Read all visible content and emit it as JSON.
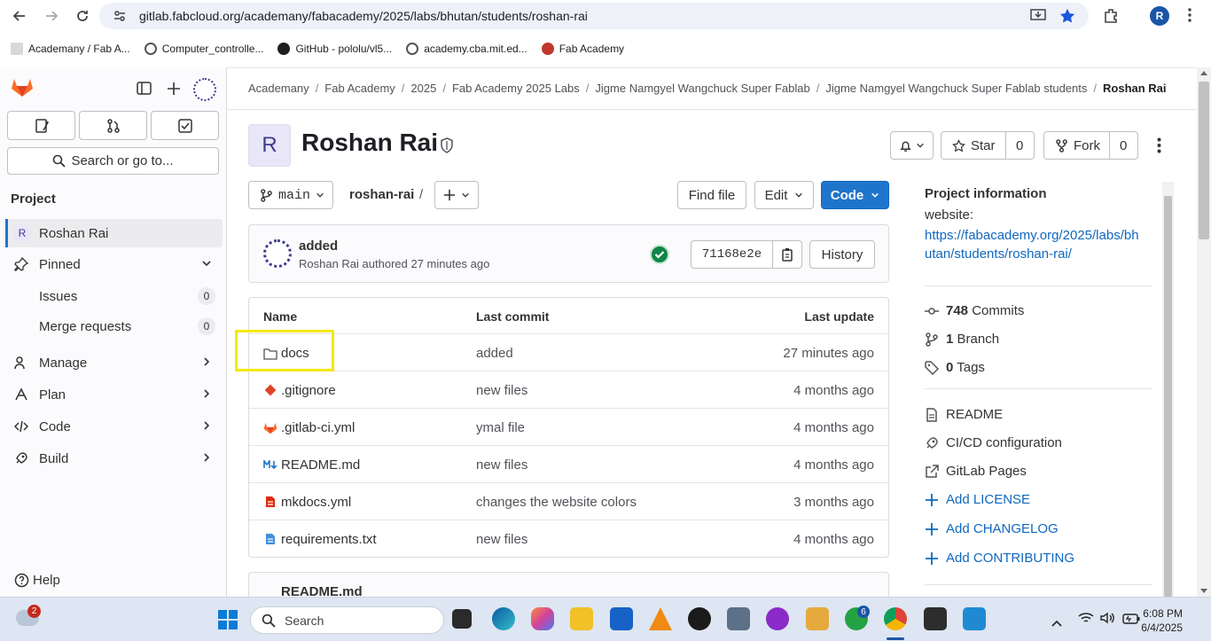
{
  "browser": {
    "url": "gitlab.fabcloud.org/academany/fabacademy/2025/labs/bhutan/students/roshan-rai",
    "profile_initial": "R",
    "bookmarks": [
      "Academany / Fab A...",
      "Computer_controlle...",
      "GitHub - pololu/vl5...",
      "academy.cba.mit.ed...",
      "Fab Academy"
    ]
  },
  "sidebar": {
    "search_label": "Search or go to...",
    "section_label": "Project",
    "project_initial": "R",
    "project_name": "Roshan Rai",
    "pinned_label": "Pinned",
    "issues_label": "Issues",
    "issues_count": "0",
    "mr_label": "Merge requests",
    "mr_count": "0",
    "manage_label": "Manage",
    "plan_label": "Plan",
    "code_label": "Code",
    "build_label": "Build",
    "help_label": "Help"
  },
  "breadcrumb": [
    "Academany",
    "Fab Academy",
    "2025",
    "Fab Academy 2025 Labs",
    "Jigme Namgyel Wangchuck Super Fablab",
    "Jigme Namgyel Wangchuck Super Fablab students",
    "Roshan Rai"
  ],
  "project": {
    "initial": "R",
    "title": "Roshan Rai",
    "star_label": "Star",
    "star_count": "0",
    "fork_label": "Fork",
    "fork_count": "0"
  },
  "repo_bar": {
    "branch": "main",
    "path": "roshan-rai",
    "path_sep": "/",
    "find_file": "Find file",
    "edit": "Edit",
    "code": "Code"
  },
  "last_commit": {
    "message": "added",
    "author_line": "Roshan Rai authored 27 minutes ago",
    "sha": "71168e2e",
    "history": "History"
  },
  "file_table": {
    "headers": {
      "name": "Name",
      "last_commit": "Last commit",
      "last_update": "Last update"
    },
    "rows": [
      {
        "name": "docs",
        "commit": "added",
        "updated": "27 minutes ago",
        "icon": "folder-icon"
      },
      {
        "name": ".gitignore",
        "commit": "new files",
        "updated": "4 months ago",
        "icon": "git-icon"
      },
      {
        "name": ".gitlab-ci.yml",
        "commit": "ymal file",
        "updated": "4 months ago",
        "icon": "gitlab-icon"
      },
      {
        "name": "README.md",
        "commit": "new files",
        "updated": "4 months ago",
        "icon": "markdown-icon"
      },
      {
        "name": "mkdocs.yml",
        "commit": "changes the website colors",
        "updated": "3 months ago",
        "icon": "yaml-icon"
      },
      {
        "name": "requirements.txt",
        "commit": "new files",
        "updated": "4 months ago",
        "icon": "text-file-icon"
      }
    ]
  },
  "readme_header": "README.md",
  "info": {
    "title": "Project information",
    "website_label": "website:",
    "website_line1": "https://fabacademy.org/2025/labs/bh",
    "website_line2": "utan/students/roshan-rai/",
    "commits_count": "748",
    "commits_label": "Commits",
    "branch_count": "1",
    "branch_label": "Branch",
    "tags_count": "0",
    "tags_label": "Tags",
    "readme": "README",
    "cicd": "CI/CD configuration",
    "pages": "GitLab Pages",
    "add_license": "Add LICENSE",
    "add_changelog": "Add CHANGELOG",
    "add_contributing": "Add CONTRIBUTING"
  },
  "taskbar": {
    "weather_badge": "2",
    "search_label": "Search",
    "whatsapp_badge": "6",
    "time": "6:08 PM",
    "date": "6/4/2025"
  },
  "colors": {
    "accent": "#1f75cb",
    "highlight": "#f5e80d",
    "success": "#108548"
  }
}
